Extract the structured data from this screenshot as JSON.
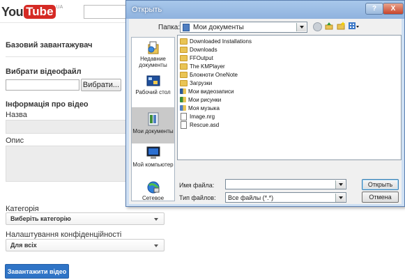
{
  "yt": {
    "logo_you": "You",
    "logo_tube": "Tube",
    "logo_region": "UA",
    "uploader_title": "Базовий завантажувач",
    "choose_video": "Вибрати відеофайл",
    "browse_button": "Вибрати...",
    "video_info": "Інформація про відео",
    "name_label": "Назва",
    "desc_label": "Опис",
    "category_label": "Категорія",
    "category_value": "Виберіть категорію",
    "privacy_label": "Налаштування конфіденційності",
    "privacy_value": "Для всіх",
    "upload_button": "Завантажити відео"
  },
  "dialog": {
    "title": "Открыть",
    "help_btn": "?",
    "close_btn": "X",
    "look_in_label": "Папка:",
    "look_in_value": "Мои документы",
    "places": [
      {
        "label": "Недавние документы",
        "icon": "recent-docs-icon"
      },
      {
        "label": "Рабочий стол",
        "icon": "desktop-icon"
      },
      {
        "label": "Мои документы",
        "icon": "my-documents-icon",
        "selected": true
      },
      {
        "label": "Мой компьютер",
        "icon": "my-computer-icon"
      },
      {
        "label": "Сетевое",
        "icon": "network-icon"
      }
    ],
    "files": [
      {
        "name": "Downloaded Installations",
        "type": "folder"
      },
      {
        "name": "Downloads",
        "type": "folder"
      },
      {
        "name": "FFOutput",
        "type": "folder"
      },
      {
        "name": "The KMPlayer",
        "type": "folder"
      },
      {
        "name": "Блокноти OneNote",
        "type": "folder"
      },
      {
        "name": "Загрузки",
        "type": "folder"
      },
      {
        "name": "Мои видеозаписи",
        "type": "video-folder"
      },
      {
        "name": "Мои рисунки",
        "type": "pictures-folder"
      },
      {
        "name": "Моя музыка",
        "type": "music-folder"
      },
      {
        "name": "Image.nrg",
        "type": "file"
      },
      {
        "name": "Rescue.asd",
        "type": "file"
      }
    ],
    "filename_label": "Имя файла:",
    "filename_value": "",
    "filetype_label": "Тип файлов:",
    "filetype_value": "Все файлы (*.*)",
    "open_button": "Открыть",
    "cancel_button": "Отмена"
  }
}
